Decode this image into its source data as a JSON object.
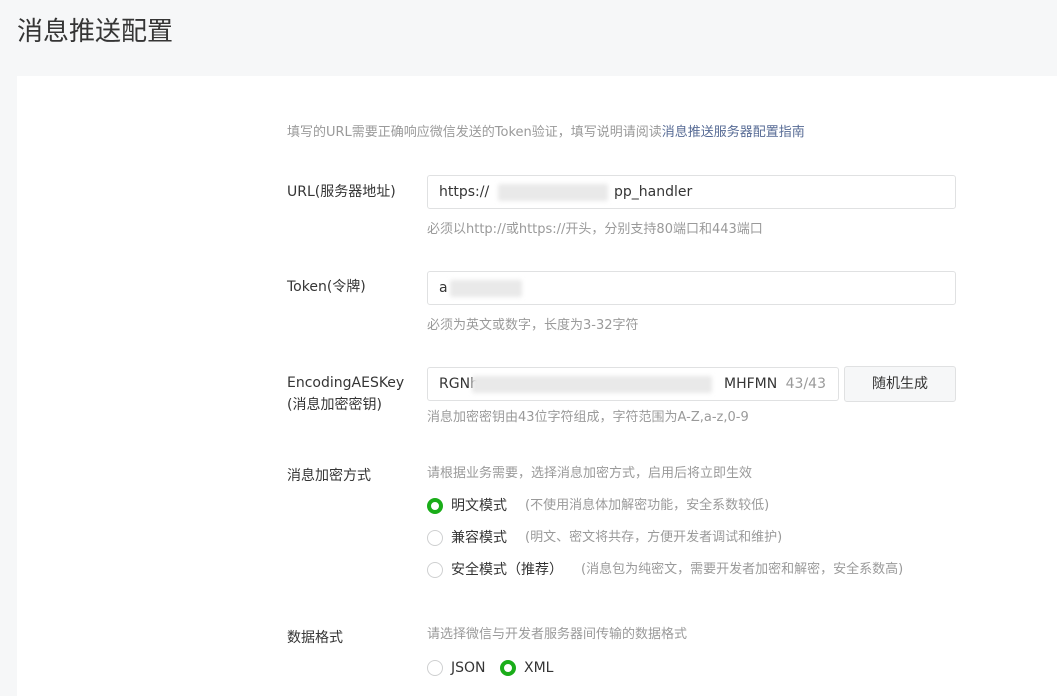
{
  "page": {
    "title": "消息推送配置"
  },
  "intro": {
    "text": "填写的URL需要正确响应微信发送的Token验证，填写说明请阅读",
    "link": "消息推送服务器配置指南"
  },
  "url_field": {
    "label": "URL(服务器地址)",
    "value_prefix": "https://",
    "value_suffix": "pp_handler",
    "hint": "必须以http://或https://开头，分别支持80端口和443端口"
  },
  "token_field": {
    "label": "Token(令牌)",
    "value_prefix": "a",
    "hint": "必须为英文或数字，长度为3-32字符"
  },
  "aes_field": {
    "label_line1": "EncodingAESKey",
    "label_line2": "(消息加密密钥)",
    "value_prefix": "RGNh",
    "value_suffix": "MHFMN",
    "counter": "43/43",
    "generate_button": "随机生成",
    "hint": "消息加密密钥由43位字符组成，字符范围为A-Z,a-z,0-9"
  },
  "encrypt_mode": {
    "label": "消息加密方式",
    "hint": "请根据业务需要，选择消息加密方式，启用后将立即生效",
    "options": [
      {
        "label": "明文模式",
        "desc": "(不使用消息体加解密功能，安全系数较低)",
        "checked": true
      },
      {
        "label": "兼容模式",
        "desc": "(明文、密文将共存，方便开发者调试和维护)",
        "checked": false
      },
      {
        "label": "安全模式（推荐）",
        "desc": "(消息包为纯密文，需要开发者加密和解密，安全系数高)",
        "checked": false
      }
    ]
  },
  "data_format": {
    "label": "数据格式",
    "hint": "请选择微信与开发者服务器间传输的数据格式",
    "options": [
      {
        "label": "JSON",
        "checked": false
      },
      {
        "label": "XML",
        "checked": true
      }
    ]
  },
  "colors": {
    "accent": "#1aad19",
    "link": "#576b95"
  }
}
